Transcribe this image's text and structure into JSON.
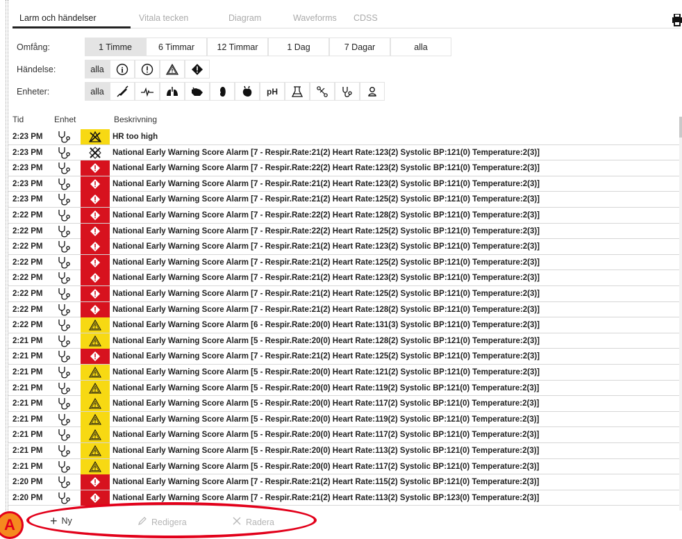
{
  "tabs": [
    "Larm och händelser",
    "Vitala tecken",
    "Diagram",
    "Waveforms",
    "CDSS"
  ],
  "filters": {
    "scope": {
      "label": "Omfång:",
      "options": [
        "1 Timme",
        "6 Timmar",
        "12 Timmar",
        "1 Dag",
        "7 Dagar",
        "alla"
      ],
      "selected": "1 Timme"
    },
    "event": {
      "label": "Händelse:",
      "all_label": "alla",
      "icons": [
        "info-icon",
        "exclamation-icon",
        "warning-triangle-icon",
        "diamond-alert-icon"
      ]
    },
    "units": {
      "label": "Enheter:",
      "all_label": "alla",
      "ph_label": "pH",
      "icons": [
        "syringe-icon",
        "ecg-wave-icon",
        "lungs-icon",
        "pump-icon",
        "kidney-icon",
        "heart-icon",
        "ph-icon",
        "lab-flask-icon",
        "bones-icon",
        "stethoscope-icon",
        "person-icon"
      ]
    }
  },
  "columns": {
    "time": "Tid",
    "device": "Enhet",
    "description": "Beskrivning"
  },
  "rows": [
    {
      "time": "2:23 PM",
      "severity": "silenced",
      "desc": "HR too high"
    },
    {
      "time": "2:23 PM",
      "severity": "silenced-red",
      "desc": "National Early Warning Score Alarm [7 - Respir.Rate:21(2) Heart Rate:123(2) Systolic BP:121(0) Temperature:2(3)]"
    },
    {
      "time": "2:23 PM",
      "severity": "red",
      "desc": "National Early Warning Score Alarm [7 - Respir.Rate:22(2) Heart Rate:123(2) Systolic BP:121(0) Temperature:2(3)]"
    },
    {
      "time": "2:23 PM",
      "severity": "red",
      "desc": "National Early Warning Score Alarm [7 - Respir.Rate:21(2) Heart Rate:123(2) Systolic BP:121(0) Temperature:2(3)]"
    },
    {
      "time": "2:23 PM",
      "severity": "red",
      "desc": "National Early Warning Score Alarm [7 - Respir.Rate:21(2) Heart Rate:125(2) Systolic BP:121(0) Temperature:2(3)]"
    },
    {
      "time": "2:22 PM",
      "severity": "red",
      "desc": "National Early Warning Score Alarm [7 - Respir.Rate:22(2) Heart Rate:128(2) Systolic BP:121(0) Temperature:2(3)]"
    },
    {
      "time": "2:22 PM",
      "severity": "red",
      "desc": "National Early Warning Score Alarm [7 - Respir.Rate:22(2) Heart Rate:125(2) Systolic BP:121(0) Temperature:2(3)]"
    },
    {
      "time": "2:22 PM",
      "severity": "red",
      "desc": "National Early Warning Score Alarm [7 - Respir.Rate:21(2) Heart Rate:123(2) Systolic BP:121(0) Temperature:2(3)]"
    },
    {
      "time": "2:22 PM",
      "severity": "red",
      "desc": "National Early Warning Score Alarm [7 - Respir.Rate:21(2) Heart Rate:125(2) Systolic BP:121(0) Temperature:2(3)]"
    },
    {
      "time": "2:22 PM",
      "severity": "red",
      "desc": "National Early Warning Score Alarm [7 - Respir.Rate:21(2) Heart Rate:123(2) Systolic BP:121(0) Temperature:2(3)]"
    },
    {
      "time": "2:22 PM",
      "severity": "red",
      "desc": "National Early Warning Score Alarm [7 - Respir.Rate:21(2) Heart Rate:125(2) Systolic BP:121(0) Temperature:2(3)]"
    },
    {
      "time": "2:22 PM",
      "severity": "red",
      "desc": "National Early Warning Score Alarm [7 - Respir.Rate:21(2) Heart Rate:128(2) Systolic BP:121(0) Temperature:2(3)]"
    },
    {
      "time": "2:22 PM",
      "severity": "yellow",
      "desc": "National Early Warning Score Alarm [6 - Respir.Rate:20(0) Heart Rate:131(3) Systolic BP:121(0) Temperature:2(3)]"
    },
    {
      "time": "2:21 PM",
      "severity": "yellow",
      "desc": "National Early Warning Score Alarm [5 - Respir.Rate:20(0) Heart Rate:128(2) Systolic BP:121(0) Temperature:2(3)]"
    },
    {
      "time": "2:21 PM",
      "severity": "red",
      "desc": "National Early Warning Score Alarm [7 - Respir.Rate:21(2) Heart Rate:125(2) Systolic BP:121(0) Temperature:2(3)]"
    },
    {
      "time": "2:21 PM",
      "severity": "yellow",
      "desc": "National Early Warning Score Alarm [5 - Respir.Rate:20(0) Heart Rate:121(2) Systolic BP:121(0) Temperature:2(3)]"
    },
    {
      "time": "2:21 PM",
      "severity": "yellow",
      "desc": "National Early Warning Score Alarm [5 - Respir.Rate:20(0) Heart Rate:119(2) Systolic BP:121(0) Temperature:2(3)]"
    },
    {
      "time": "2:21 PM",
      "severity": "yellow",
      "desc": "National Early Warning Score Alarm [5 - Respir.Rate:20(0) Heart Rate:117(2) Systolic BP:121(0) Temperature:2(3)]"
    },
    {
      "time": "2:21 PM",
      "severity": "yellow",
      "desc": "National Early Warning Score Alarm [5 - Respir.Rate:20(0) Heart Rate:119(2) Systolic BP:121(0) Temperature:2(3)]"
    },
    {
      "time": "2:21 PM",
      "severity": "yellow",
      "desc": "National Early Warning Score Alarm [5 - Respir.Rate:20(0) Heart Rate:117(2) Systolic BP:121(0) Temperature:2(3)]"
    },
    {
      "time": "2:21 PM",
      "severity": "yellow",
      "desc": "National Early Warning Score Alarm [5 - Respir.Rate:20(0) Heart Rate:113(2) Systolic BP:121(0) Temperature:2(3)]"
    },
    {
      "time": "2:21 PM",
      "severity": "yellow",
      "desc": "National Early Warning Score Alarm [5 - Respir.Rate:20(0) Heart Rate:117(2) Systolic BP:121(0) Temperature:2(3)]"
    },
    {
      "time": "2:20 PM",
      "severity": "red",
      "desc": "National Early Warning Score Alarm [7 - Respir.Rate:21(2) Heart Rate:115(2) Systolic BP:121(0) Temperature:2(3)]"
    },
    {
      "time": "2:20 PM",
      "severity": "red",
      "desc": "National Early Warning Score Alarm [7 - Respir.Rate:21(2) Heart Rate:113(2) Systolic BP:123(0) Temperature:2(3)]"
    }
  ],
  "bottom": {
    "new_label": "Ny",
    "edit_label": "Redigera",
    "delete_label": "Radera"
  },
  "annotation": {
    "badge": "A"
  },
  "colors": {
    "alarm_red": "#d7121e",
    "alarm_yellow": "#f7d913",
    "annotation_red": "#e2001a",
    "annotation_orange": "#f58a1f"
  }
}
